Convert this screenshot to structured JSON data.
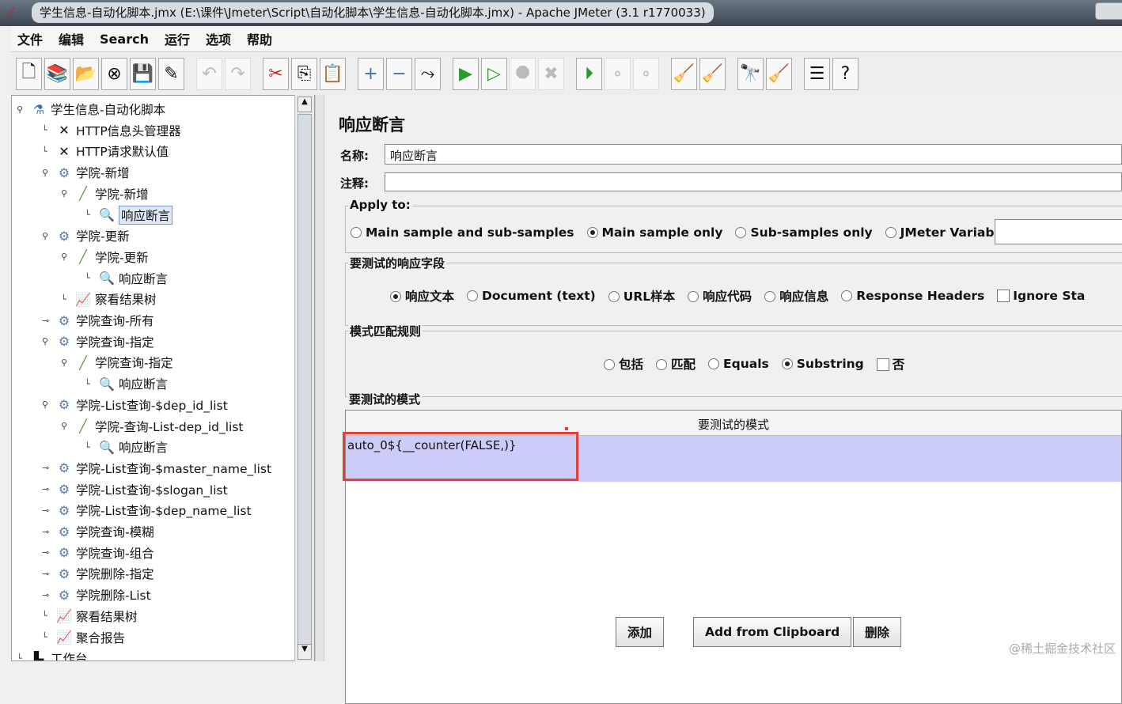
{
  "window": {
    "title": "学生信息-自动化脚本.jmx (E:\\课件\\Jmeter\\Script\\自动化脚本\\学生信息-自动化脚本.jmx) - Apache JMeter (3.1 r1770033)"
  },
  "menu": [
    "文件",
    "编辑",
    "Search",
    "运行",
    "选项",
    "帮助"
  ],
  "toolbar": [
    {
      "icon": "new-icon",
      "g": "🗋"
    },
    {
      "icon": "templates-icon",
      "g": "📚"
    },
    {
      "icon": "open-icon",
      "g": "📂"
    },
    {
      "icon": "close-icon",
      "g": "⊗"
    },
    {
      "icon": "save-icon",
      "g": "💾"
    },
    {
      "icon": "save-as-icon",
      "g": "✎"
    },
    "sep",
    {
      "icon": "undo-icon",
      "g": "↶",
      "d": 1
    },
    {
      "icon": "redo-icon",
      "g": "↷",
      "d": 1
    },
    "sep",
    {
      "icon": "cut-icon",
      "g": "✂"
    },
    {
      "icon": "copy-icon",
      "g": "⎘"
    },
    {
      "icon": "paste-icon",
      "g": "📋"
    },
    "sep",
    {
      "icon": "expand-icon",
      "g": "+"
    },
    {
      "icon": "collapse-icon",
      "g": "−"
    },
    {
      "icon": "toggle-icon",
      "g": "⤳"
    },
    "sep",
    {
      "icon": "start-icon",
      "g": "▶"
    },
    {
      "icon": "start-no-pause-icon",
      "g": "▷"
    },
    {
      "icon": "stop-icon",
      "g": "⯃",
      "d": 1
    },
    {
      "icon": "shutdown-icon",
      "g": "✖",
      "d": 1
    },
    "sep",
    {
      "icon": "remote-start-icon",
      "g": "⏵"
    },
    {
      "icon": "remote-stop-icon",
      "g": "∘",
      "d": 1
    },
    {
      "icon": "remote-shutdown-icon",
      "g": "∘",
      "d": 1
    },
    "sep",
    {
      "icon": "clear-icon",
      "g": "🧹"
    },
    {
      "icon": "clear-all-icon",
      "g": "🧹"
    },
    "sep",
    {
      "icon": "search-icon",
      "g": "🔭"
    },
    {
      "icon": "reset-search-icon",
      "g": "🧹"
    },
    "sep",
    {
      "icon": "function-helper-icon",
      "g": "☰"
    },
    {
      "icon": "help-icon",
      "g": "?"
    }
  ],
  "tree": [
    {
      "label": "学生信息-自动化脚本",
      "lvl": 0,
      "icon": "test-plan-icon",
      "g": "⚗",
      "exp": "open"
    },
    {
      "label": "HTTP信息头管理器",
      "lvl": 1,
      "icon": "config-tool-icon",
      "g": "✕"
    },
    {
      "label": "HTTP请求默认值",
      "lvl": 1,
      "icon": "config-tool-icon",
      "g": "✕"
    },
    {
      "label": "学院-新增",
      "lvl": 1,
      "icon": "thread-group-icon",
      "g": "⚙",
      "exp": "open"
    },
    {
      "label": "学院-新增",
      "lvl": 2,
      "icon": "sampler-icon",
      "g": "╱",
      "exp": "open"
    },
    {
      "label": "响应断言",
      "lvl": 3,
      "icon": "assertion-icon",
      "g": "🔍",
      "sel": true
    },
    {
      "label": "学院-更新",
      "lvl": 1,
      "icon": "thread-group-icon",
      "g": "⚙",
      "exp": "open"
    },
    {
      "label": "学院-更新",
      "lvl": 2,
      "icon": "sampler-icon",
      "g": "╱",
      "exp": "open"
    },
    {
      "label": "响应断言",
      "lvl": 3,
      "icon": "assertion-icon",
      "g": "🔍"
    },
    {
      "label": "察看结果树",
      "lvl": 2,
      "icon": "listener-icon",
      "g": "📈"
    },
    {
      "label": "学院查询-所有",
      "lvl": 1,
      "icon": "thread-group-icon",
      "g": "⚙",
      "exp": "closed"
    },
    {
      "label": "学院查询-指定",
      "lvl": 1,
      "icon": "thread-group-icon",
      "g": "⚙",
      "exp": "open"
    },
    {
      "label": "学院查询-指定",
      "lvl": 2,
      "icon": "sampler-icon",
      "g": "╱",
      "exp": "open"
    },
    {
      "label": "响应断言",
      "lvl": 3,
      "icon": "assertion-icon",
      "g": "🔍"
    },
    {
      "label": "学院-List查询-$dep_id_list",
      "lvl": 1,
      "icon": "thread-group-icon",
      "g": "⚙",
      "exp": "open"
    },
    {
      "label": "学院-查询-List-dep_id_list",
      "lvl": 2,
      "icon": "sampler-icon",
      "g": "╱",
      "exp": "open"
    },
    {
      "label": "响应断言",
      "lvl": 3,
      "icon": "assertion-icon",
      "g": "🔍"
    },
    {
      "label": "学院-List查询-$master_name_list",
      "lvl": 1,
      "icon": "thread-group-icon",
      "g": "⚙",
      "exp": "closed"
    },
    {
      "label": "学院-List查询-$slogan_list",
      "lvl": 1,
      "icon": "thread-group-icon",
      "g": "⚙",
      "exp": "closed"
    },
    {
      "label": "学院-List查询-$dep_name_list",
      "lvl": 1,
      "icon": "thread-group-icon",
      "g": "⚙",
      "exp": "closed"
    },
    {
      "label": "学院查询-模糊",
      "lvl": 1,
      "icon": "thread-group-icon",
      "g": "⚙",
      "exp": "closed"
    },
    {
      "label": "学院查询-组合",
      "lvl": 1,
      "icon": "thread-group-icon",
      "g": "⚙",
      "exp": "closed"
    },
    {
      "label": "学院删除-指定",
      "lvl": 1,
      "icon": "thread-group-icon",
      "g": "⚙",
      "exp": "closed"
    },
    {
      "label": "学院删除-List",
      "lvl": 1,
      "icon": "thread-group-icon",
      "g": "⚙",
      "exp": "closed"
    },
    {
      "label": "察看结果树",
      "lvl": 1,
      "icon": "listener-icon",
      "g": "📈"
    },
    {
      "label": "聚合报告",
      "lvl": 1,
      "icon": "listener-icon",
      "g": "📈"
    },
    {
      "label": "工作台",
      "lvl": 0,
      "icon": "workbench-icon",
      "g": "▙"
    }
  ],
  "panel": {
    "title": "响应断言",
    "name_label": "名称:",
    "name_value": "响应断言",
    "comment_label": "注释:",
    "comment_value": "",
    "apply_to": {
      "legend": "Apply to:",
      "options": [
        "Main sample and sub-samples",
        "Main sample only",
        "Sub-samples only",
        "JMeter Variable"
      ],
      "selected": 1,
      "variable_value": ""
    },
    "field": {
      "legend": "要测试的响应字段",
      "options": [
        "响应文本",
        "Document (text)",
        "URL样本",
        "响应代码",
        "响应信息",
        "Response Headers"
      ],
      "selected": 0,
      "ignore_label": "Ignore Sta"
    },
    "rules": {
      "legend": "模式匹配规则",
      "options": [
        "包括",
        "匹配",
        "Equals",
        "Substring"
      ],
      "selected": 3,
      "not_label": "否"
    },
    "patterns": {
      "legend": "要测试的模式",
      "header": "要测试的模式",
      "rows": [
        "auto_0${__counter(FALSE,)}"
      ]
    },
    "buttons": {
      "add": "添加",
      "clipboard": "Add from Clipboard",
      "delete": "删除"
    }
  },
  "watermark": "@稀土掘金技术社区"
}
